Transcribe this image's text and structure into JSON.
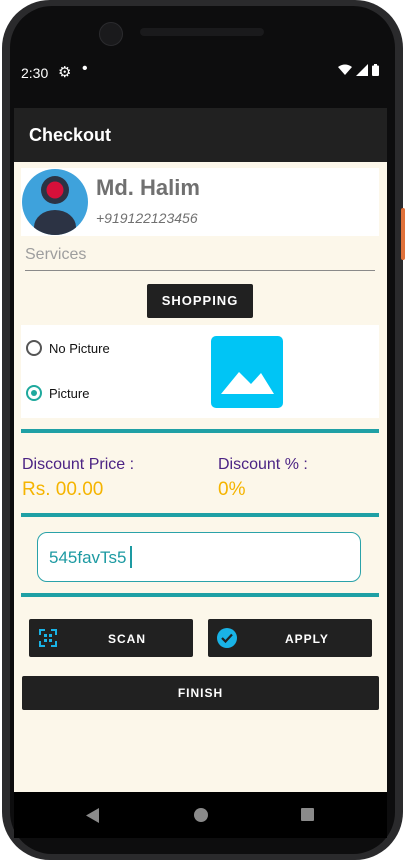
{
  "status_bar": {
    "time": "2:30",
    "left_icons": [
      "gear-icon",
      "dot-icon"
    ],
    "right_icons": [
      "wifi-icon",
      "signal-icon",
      "battery-icon"
    ]
  },
  "app_bar": {
    "title": "Checkout"
  },
  "profile": {
    "name": "Md. Halim",
    "phone": "+919122123456",
    "avatar_icon": "user-avatar-icon"
  },
  "services": {
    "placeholder": "Services"
  },
  "shopping_button": {
    "label": "SHOPPING"
  },
  "picture_options": {
    "items": [
      {
        "label": "No Picture",
        "checked": false
      },
      {
        "label": "Picture",
        "checked": true
      }
    ],
    "image_icon": "image-placeholder-icon"
  },
  "discount": {
    "price_label": "Discount Price :",
    "price_value": "Rs. 00.00",
    "percent_label": "Discount % :",
    "percent_value": "0%"
  },
  "coupon": {
    "value": "545favTs5"
  },
  "actions": {
    "scan_label": "SCAN",
    "apply_label": "APPLY",
    "finish_label": "FINISH"
  },
  "nav_bar": {
    "icons": [
      "back-icon",
      "home-icon",
      "recents-icon"
    ]
  },
  "colors": {
    "accent_teal": "#1fa0a5",
    "purple": "#4b2384",
    "yellow": "#f5b400",
    "dark": "#212121",
    "background": "#fcf7ea",
    "image_icon_blue": "#00c5f5"
  }
}
